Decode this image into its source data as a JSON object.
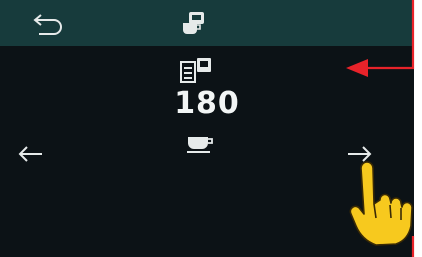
{
  "screen": {
    "counter_value": "180"
  },
  "icons": {
    "back": "back-arrow-icon",
    "mode": "cup-counter-icon",
    "counter": "counter-icon",
    "cup": "cup-icon",
    "prev": "arrow-left-icon",
    "next": "arrow-right-icon"
  },
  "colors": {
    "screen_bg": "#0c1216",
    "topbar_bg": "#173b3c",
    "icon": "#e6eaea",
    "annotation": "#e8232a",
    "hand": "#f7c91e"
  }
}
